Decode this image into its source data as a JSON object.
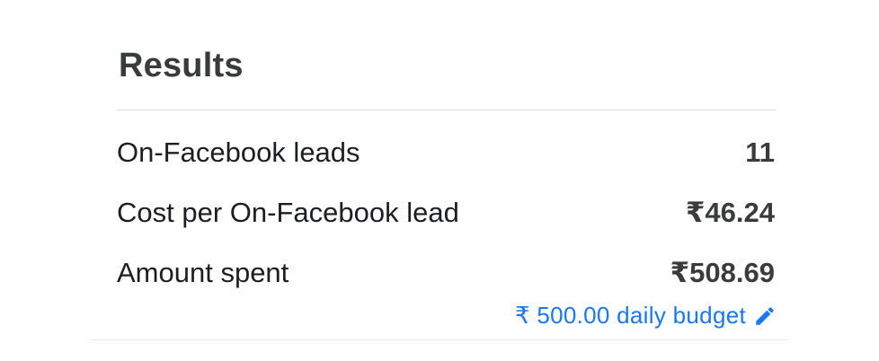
{
  "results": {
    "title": "Results",
    "rows": [
      {
        "label": "On-Facebook leads",
        "value": "11"
      },
      {
        "label": "Cost per On-Facebook lead",
        "value": "₹46.24"
      },
      {
        "label": "Amount spent",
        "value": "₹508.69"
      }
    ],
    "budget": {
      "text": "₹ 500.00 daily budget",
      "icon": "pencil-icon"
    }
  },
  "colors": {
    "link": "#1877f2",
    "text": "#1c1e21",
    "heading": "#3a3b3c",
    "divider": "#dadde1"
  }
}
